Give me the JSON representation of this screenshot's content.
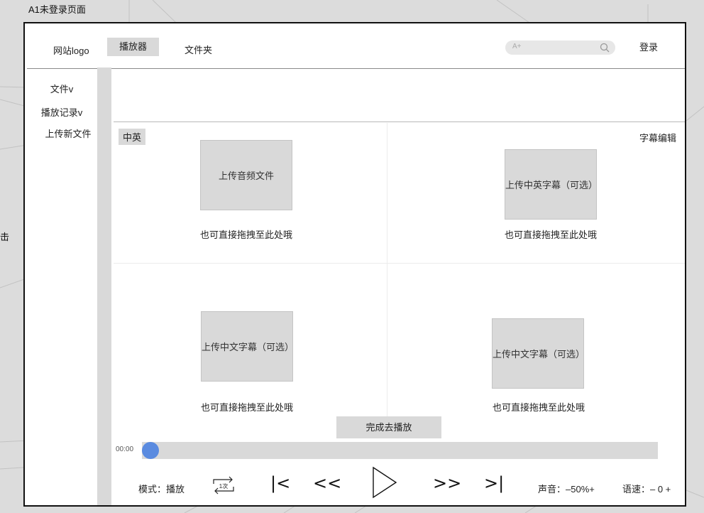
{
  "page_label": "A1未登录页面",
  "edge_label": "击",
  "nav": {
    "logo": "网站logo",
    "player": "播放器",
    "folder": "文件夹",
    "search_placeholder": "A+",
    "login": "登录"
  },
  "sidebar": {
    "items": [
      {
        "label": "文件v"
      },
      {
        "label": "播放记录v"
      },
      {
        "label": "上传新文件"
      }
    ]
  },
  "main": {
    "lang_tab": "中英",
    "subtitle_edit": "字幕编辑",
    "panels": [
      {
        "button": "上传音频文件",
        "hint": "也可直接拖拽至此处哦"
      },
      {
        "button": "上传中英字幕（可选）",
        "hint": "也可直接拖拽至此处哦"
      },
      {
        "button": "上传中文字幕（可选）",
        "hint": "也可直接拖拽至此处哦"
      },
      {
        "button": "上传中文字幕（可选）",
        "hint": "也可直接拖拽至此处哦"
      }
    ],
    "finish_button": "完成去播放"
  },
  "player": {
    "time": "00:00",
    "progress": 0,
    "mode": "模式：播放",
    "loop_label": "1次",
    "prev_label": "|<",
    "rewind_label": "<<",
    "forward_label": ">>",
    "next_label": ">|",
    "volume": "声音：–50%+",
    "speed": "语速：– 0 +"
  },
  "colors": {
    "accent": "#5a8be0",
    "placeholder_gray": "#d9d9d9",
    "frame_border": "#111111",
    "canvas": "#dcdcdc"
  }
}
